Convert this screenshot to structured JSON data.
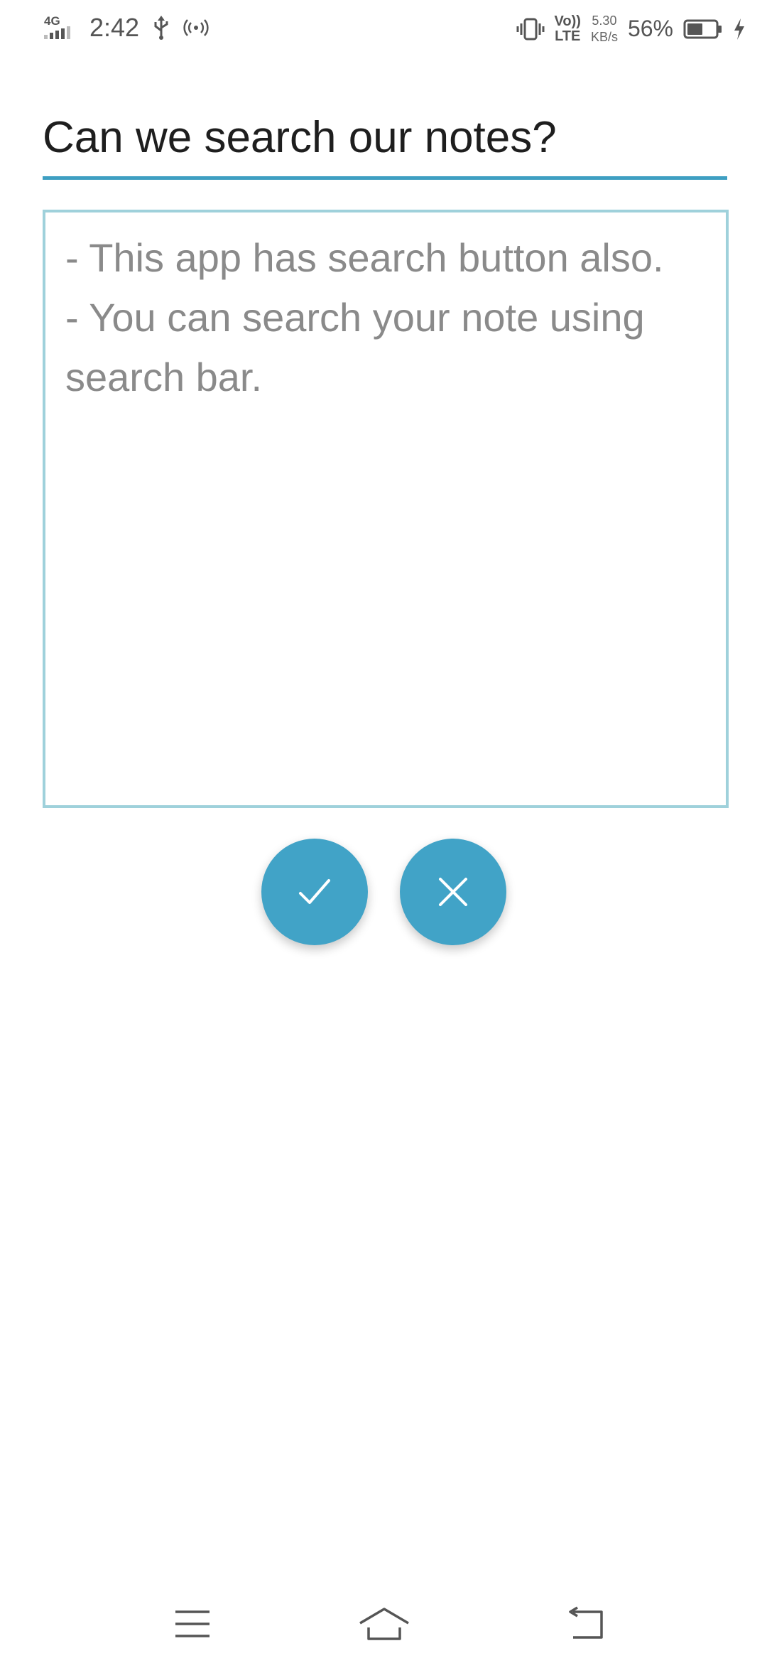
{
  "status_bar": {
    "network": "4G",
    "time": "2:42",
    "volte_top": "Vo))",
    "volte_bottom": "LTE",
    "speed_value": "5.30",
    "speed_unit": "KB/s",
    "battery_percent": "56%",
    "battery_level": 0.56
  },
  "note": {
    "title": "Can we search our notes?",
    "body": "- This app has search button also.\n- You can search your note using search bar."
  },
  "actions": {
    "save_icon": "check-icon",
    "cancel_icon": "close-icon"
  },
  "navigation": {
    "menu_icon": "menu-icon",
    "home_icon": "home-icon",
    "back_icon": "back-icon"
  },
  "colors": {
    "accent": "#41a3c7",
    "title_underline": "#3e9fc2",
    "body_border": "#9fd1db",
    "body_text": "#8a8a8a",
    "title_text": "#1e1e1e"
  }
}
